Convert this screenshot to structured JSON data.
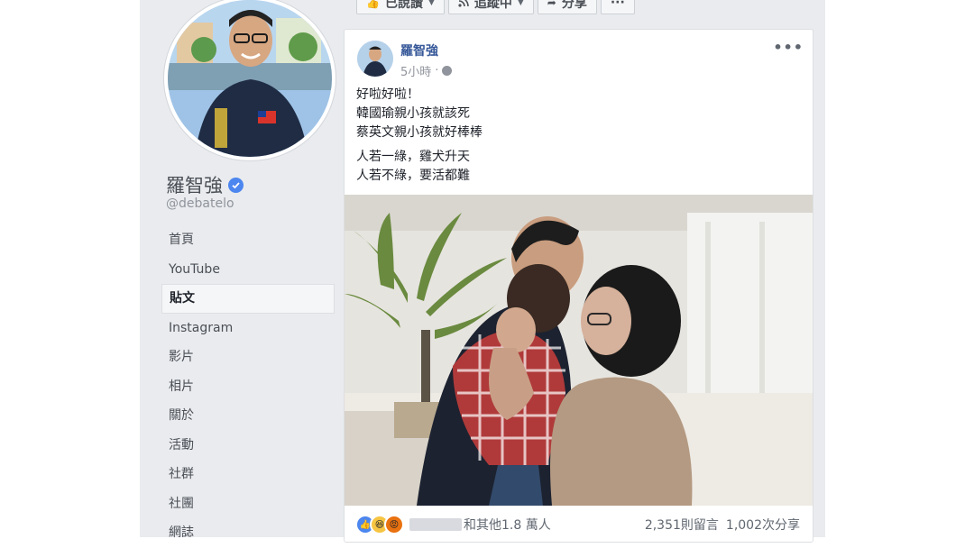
{
  "top_actions": [
    {
      "label": "已說讚",
      "icon": "thumbs-up-icon"
    },
    {
      "label": "追蹤中",
      "icon": "rss-icon"
    },
    {
      "label": "分享",
      "icon": "share-arrow-icon"
    },
    {
      "label": "···",
      "icon": "more-icon"
    }
  ],
  "profile": {
    "name": "羅智強",
    "handle": "@debatelo"
  },
  "nav": {
    "items": [
      {
        "label": "首頁"
      },
      {
        "label": "YouTube"
      },
      {
        "label": "貼文"
      },
      {
        "label": "Instagram"
      },
      {
        "label": "影片"
      },
      {
        "label": "相片"
      },
      {
        "label": "關於"
      },
      {
        "label": "活動"
      },
      {
        "label": "社群"
      },
      {
        "label": "社團"
      },
      {
        "label": "網誌"
      }
    ],
    "active_index": 2
  },
  "post": {
    "author": "羅智強",
    "time": "5小時",
    "options": "•••",
    "lines": [
      "好啦好啦！",
      "韓國瑜親小孩就該死",
      "蔡英文親小孩就好棒棒",
      "人若一綠，雞犬升天",
      "人若不綠，要活都難"
    ],
    "reactions_text": "和其他1.8 萬人",
    "comments": "2,351則留言",
    "shares": "1,002次分享"
  },
  "colors": {
    "link_blue": "#365899",
    "page_background": "#e9ebee",
    "like_blue": "#4c86ef"
  }
}
